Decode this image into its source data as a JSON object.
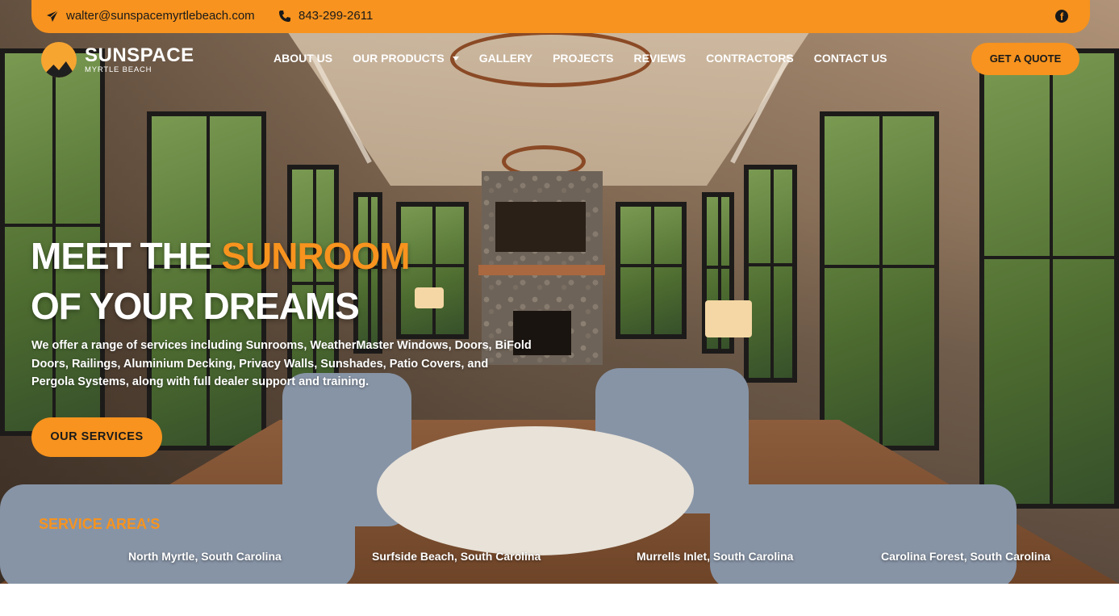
{
  "topbar": {
    "email": "walter@sunspacemyrtlebeach.com",
    "phone": "843-299-2611",
    "email_icon": "paper-plane-icon",
    "phone_icon": "phone-icon",
    "social_icon": "facebook-icon"
  },
  "logo": {
    "name": "SUNSPACE",
    "tagline": "MYRTLE BEACH"
  },
  "nav": {
    "items": [
      {
        "label": "ABOUT US"
      },
      {
        "label": "OUR PRODUCTS"
      },
      {
        "label": "GALLERY"
      },
      {
        "label": "PROJECTS"
      },
      {
        "label": "REVIEWS"
      },
      {
        "label": "CONTRACTORS"
      },
      {
        "label": "CONTACT US"
      }
    ],
    "quote_label": "GET A QUOTE"
  },
  "hero": {
    "title_line1_a": "MEET THE ",
    "title_line1_b": "SUNROOM",
    "title_line2": "OF YOUR DREAMS",
    "subtitle": "We offer a range of services including Sunrooms, WeatherMaster Windows, Doors, BiFold Doors, Railings, Aluminium Decking, Privacy Walls, Sunshades, Patio Covers, and Pergola Systems, along with full dealer support and training.",
    "cta_label": "OUR SERVICES"
  },
  "service_areas": {
    "title": "SERVICE AREA'S",
    "items": [
      "North Myrtle, South Carolina",
      "Surfside Beach, South Carolina",
      "Murrells Inlet, South Carolina",
      "Carolina Forest, South Carolina"
    ]
  },
  "colors": {
    "accent": "#f7931e",
    "text_dark": "#1a1a1a",
    "text_light": "#ffffff"
  }
}
